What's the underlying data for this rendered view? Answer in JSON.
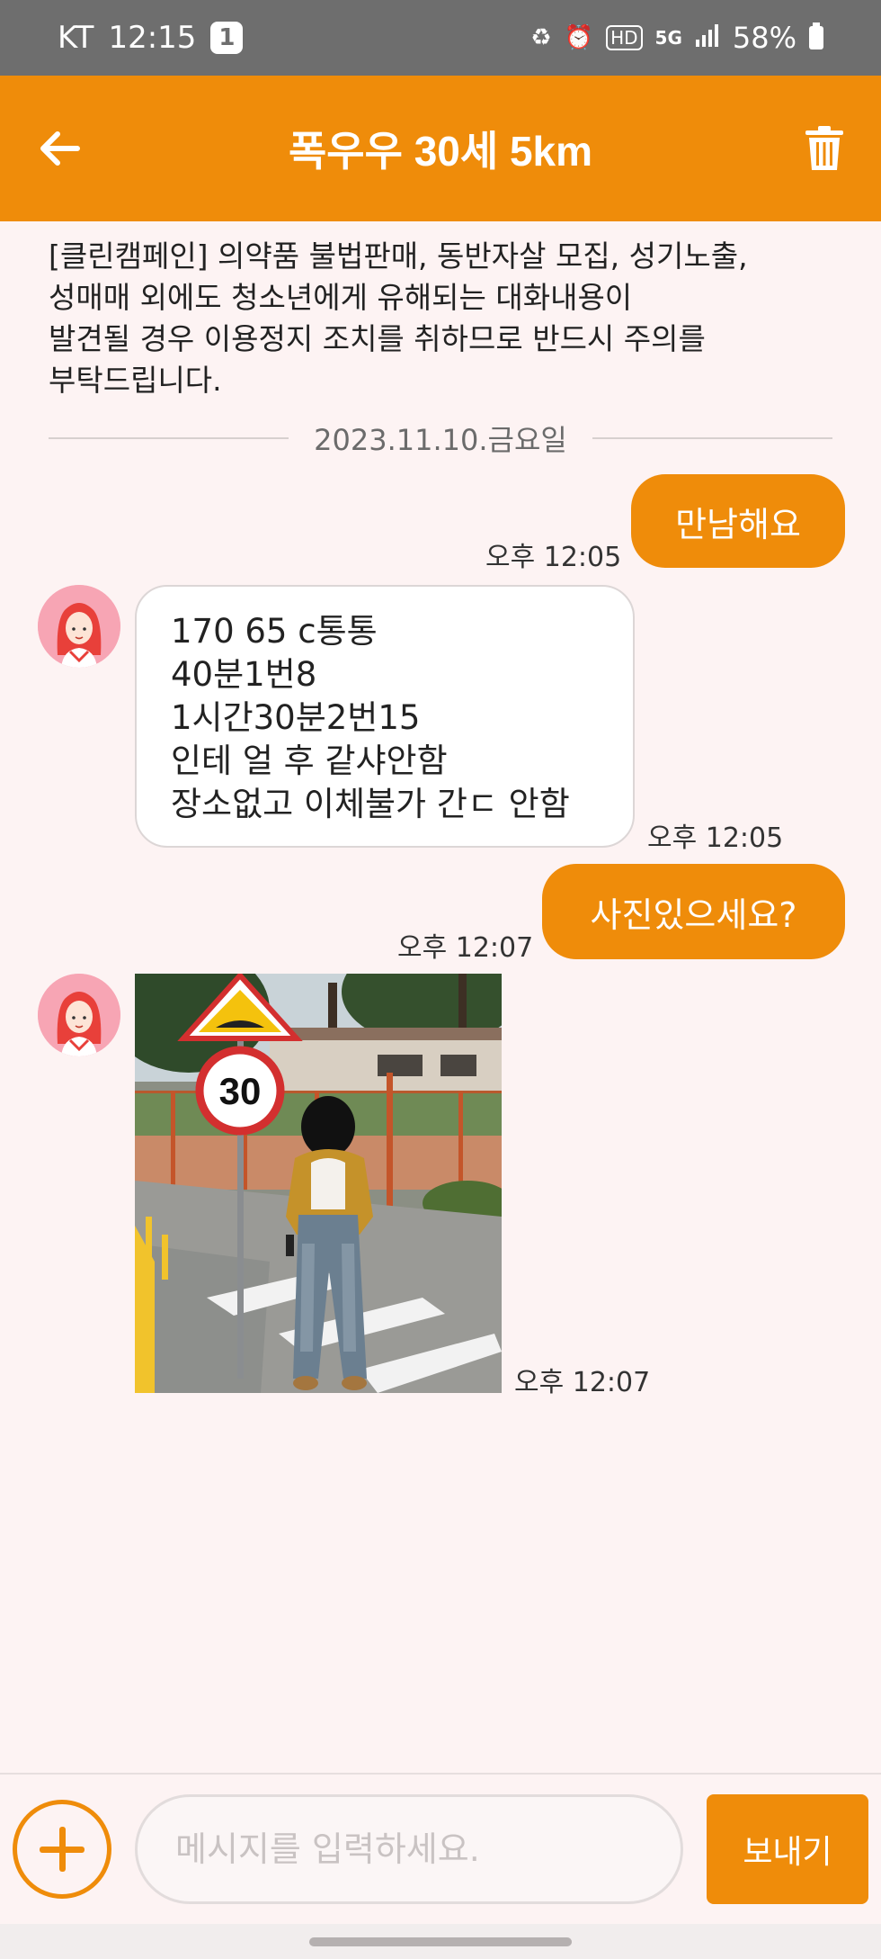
{
  "status_bar": {
    "carrier": "KT",
    "time": "12:15",
    "notification_count": "1",
    "hd_label": "HD",
    "network_label": "5G",
    "battery": "58%"
  },
  "header": {
    "title": "폭우우 30세 5km"
  },
  "notice": {
    "lines": [
      "[클린캠페인] 의약품 불법판매, 동반자살 모집, 성기노출,",
      "성매매 외에도 청소년에게 유해되는 대화내용이",
      "발견될 경우 이용정지 조치를 취하므로 반드시 주의를",
      "부탁드립니다."
    ]
  },
  "date_divider": "2023.11.10.금요일",
  "messages": [
    {
      "direction": "out",
      "text": "만남해요",
      "time": "오후 12:05"
    },
    {
      "direction": "in",
      "lines": [
        "170 65 c통통",
        "40분1번8",
        "1시간30분2번15",
        "인테 얼 후 같샤안함",
        "장소없고 이체불가  간ㄷ 안함"
      ],
      "time": "오후 12:05"
    },
    {
      "direction": "out",
      "text": "사진있으세요?",
      "time": "오후 12:07"
    },
    {
      "direction": "in",
      "type": "photo",
      "sign_speed": "30",
      "time": "오후 12:07"
    }
  ],
  "composer": {
    "placeholder": "메시지를 입력하세요.",
    "value": "",
    "send_label": "보내기"
  },
  "colors": {
    "accent": "#ef8c0a",
    "background": "#fdf3f3"
  }
}
